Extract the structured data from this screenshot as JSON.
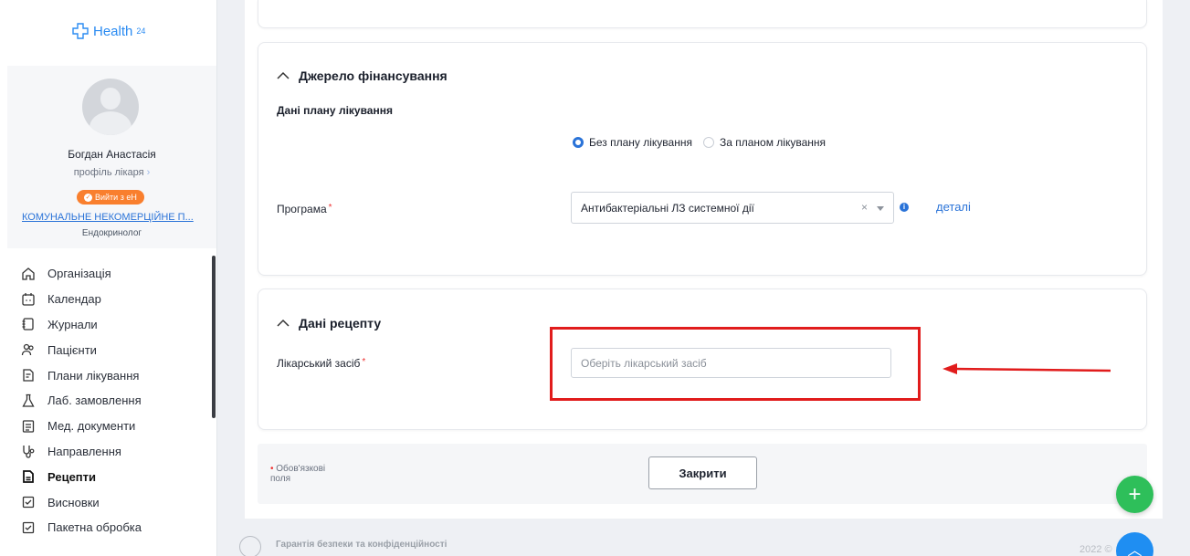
{
  "app": {
    "logo_text": "Health",
    "logo_sup": "24"
  },
  "profile": {
    "name": "Богдан Анастасія",
    "role_link": "профіль лікаря",
    "ehealth_button": "Вийти з eH",
    "organization": "КОМУНАЛЬНЕ НЕКОМЕРЦІЙНЕ П...",
    "specialty": "Ендокринолог"
  },
  "menu": {
    "items": [
      {
        "label": "Організація",
        "icon": "home-icon"
      },
      {
        "label": "Календар",
        "icon": "calendar-icon"
      },
      {
        "label": "Журнали",
        "icon": "journal-icon"
      },
      {
        "label": "Пацієнти",
        "icon": "patients-icon"
      },
      {
        "label": "Плани лікування",
        "icon": "treatment-plan-icon"
      },
      {
        "label": "Лаб. замовлення",
        "icon": "flask-icon"
      },
      {
        "label": "Мед. документи",
        "icon": "document-icon"
      },
      {
        "label": "Направлення",
        "icon": "referral-icon"
      },
      {
        "label": "Рецепти",
        "icon": "prescription-icon",
        "active": true
      },
      {
        "label": "Висновки",
        "icon": "checklist-icon"
      },
      {
        "label": "Пакетна обробка",
        "icon": "batch-icon"
      }
    ]
  },
  "financing": {
    "title": "Джерело фінансування",
    "plan_subtitle": "Дані плану лікування",
    "radio_without_plan": "Без плану лікування",
    "radio_with_plan": "За планом лікування",
    "program_label": "Програма",
    "program_value": "Антибактеріальні ЛЗ системної дії",
    "details_link": "деталі"
  },
  "prescription": {
    "title": "Дані рецепту",
    "medication_label": "Лікарський засіб",
    "medication_placeholder": "Оберіть лікарський засіб"
  },
  "footer": {
    "required_note": "Обов'язкові поля",
    "close_button": "Закрити",
    "security_title": "Гарантія безпеки та конфіденційності",
    "copyright": "2022 ©"
  },
  "colors": {
    "accent": "#2a73d8",
    "brand": "#2a8bf2",
    "ehealth": "#f97f2e",
    "fab_green": "#2ebf5a",
    "annotation_red": "#e11c1c"
  }
}
